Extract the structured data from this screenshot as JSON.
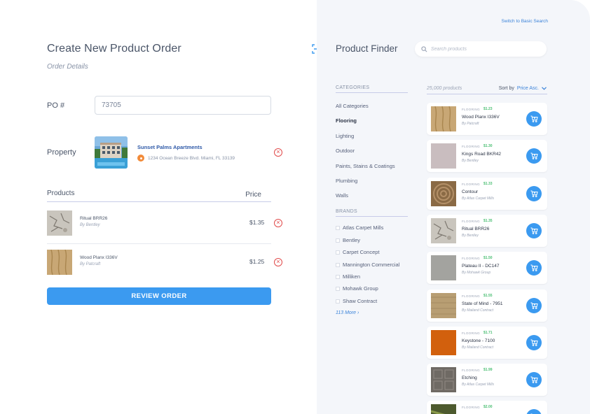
{
  "order": {
    "title": "Create New Product Order",
    "subtitle": "Order Details",
    "po_label": "PO #",
    "po_value": "73705",
    "property_label": "Property",
    "property_name": "Sunset Palms Apartments",
    "property_address": "1234 Ocean Breeze Blvd. Miami, FL 33139",
    "products_label": "Products",
    "price_label": "Price",
    "items": [
      {
        "name": "Ritual BRR26",
        "brand": "By Bentley",
        "price": "$1.35",
        "swatch": "ritual"
      },
      {
        "name": "Wood Planx I336V",
        "brand": "By Patcraft",
        "price": "$1.25",
        "swatch": "wood"
      }
    ],
    "review_button": "REVIEW ORDER"
  },
  "finder": {
    "switch_link": "Switch to Basic Search",
    "title": "Product Finder",
    "search_placeholder": "Search products",
    "categories_heading": "CATEGORIES",
    "categories": [
      "All Categories",
      "Flooring",
      "Lighting",
      "Outdoor",
      "Paints, Stains & Coatings",
      "Plumbing",
      "Walls"
    ],
    "active_category": "Flooring",
    "brands_heading": "BRANDS",
    "brands": [
      "Atlas Carpet Mills",
      "Bentley",
      "Carpet Concept",
      "Mannington Commercial",
      "Milliken",
      "Mohawk Group",
      "Shaw Contract"
    ],
    "more_link": "113 More ›",
    "results_count": "25,000 products",
    "sort_label": "Sort by",
    "sort_value": "Price Asc.",
    "products": [
      {
        "category": "FLOORING",
        "price": "$1.23",
        "name": "Wood Planx I336V",
        "brand": "By Patcraft",
        "swatch": "wood"
      },
      {
        "category": "FLOORING",
        "price": "$1.30",
        "name": "Kings Road BKR42",
        "brand": "By Bentley",
        "swatch": "kings"
      },
      {
        "category": "FLOORING",
        "price": "$1.33",
        "name": "Contour",
        "brand": "By Atlas Carpet Mills",
        "swatch": "contour"
      },
      {
        "category": "FLOORING",
        "price": "$1.35",
        "name": "Ritual BRR26",
        "brand": "By Bentley",
        "swatch": "ritual"
      },
      {
        "category": "FLOORING",
        "price": "$1.50",
        "name": "Plateau II - DC147",
        "brand": "By Mohawk Group",
        "swatch": "plateau"
      },
      {
        "category": "FLOORING",
        "price": "$1.55",
        "name": "State of Mind - 7951",
        "brand": "By Mailand Contract",
        "swatch": "state"
      },
      {
        "category": "FLOORING",
        "price": "$1.71",
        "name": "Keystone - 7100",
        "brand": "By Mailand Contract",
        "swatch": "keystone"
      },
      {
        "category": "FLOORING",
        "price": "$1.99",
        "name": "Etching",
        "brand": "By Atlas Carpet Mills",
        "swatch": "etching"
      },
      {
        "category": "FLOORING",
        "price": "$2.00",
        "name": "",
        "brand": "",
        "swatch": "last"
      }
    ]
  },
  "colors": {
    "accent": "#3b9af0",
    "price_green": "#4bbf73",
    "remove_red": "#e14b4b",
    "panel_bg": "#f4f6fa"
  }
}
